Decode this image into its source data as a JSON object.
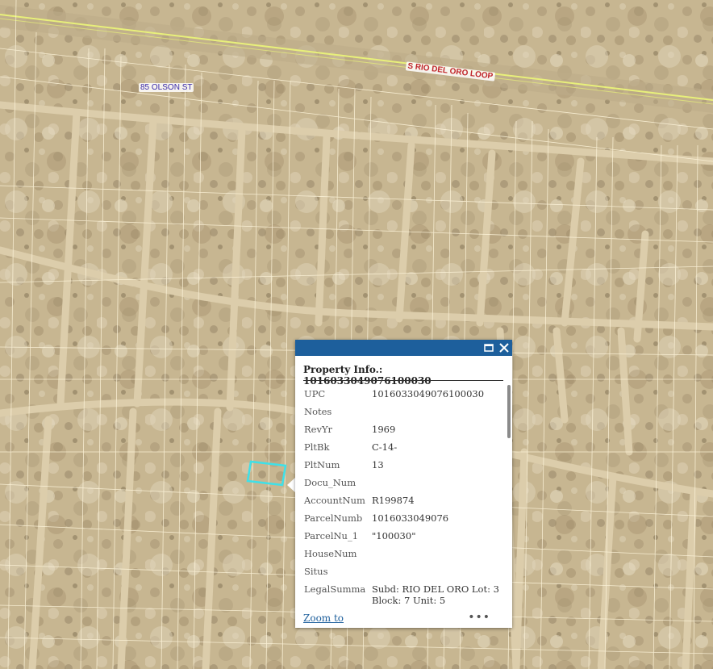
{
  "map": {
    "road_labels": {
      "olson": "85 OLSON ST",
      "rio_del_oro": "S RIO DEL ORO LOOP"
    },
    "colors": {
      "imagery_base": "#c9b897",
      "parcel_lines": "#fff8e4",
      "road": "#d9c9a6",
      "highway_line": "#e8f07a",
      "selection": "#3fe0e8"
    }
  },
  "popup": {
    "title": "Property Info.: 1016033049076100030",
    "header_color": "#1d5f9c",
    "maximize_icon": "maximize-icon",
    "close_icon": "close-icon",
    "fields": [
      {
        "key": "UPC",
        "value": "1016033049076100030"
      },
      {
        "key": "Notes",
        "value": ""
      },
      {
        "key": "RevYr",
        "value": "1969"
      },
      {
        "key": "PltBk",
        "value": "C-14-"
      },
      {
        "key": "PltNum",
        "value": "13"
      },
      {
        "key": "Docu_Num",
        "value": ""
      },
      {
        "key": "AccountNum",
        "value": "R199874"
      },
      {
        "key": "ParcelNumb",
        "value": "1016033049076"
      },
      {
        "key": "ParcelNu_1",
        "value": "\"100030\""
      },
      {
        "key": "HouseNum",
        "value": ""
      },
      {
        "key": "Situs",
        "value": ""
      },
      {
        "key": "LegalSumma",
        "value": "Subd: RIO DEL ORO Lot: 3 Block: 7 Unit: 5"
      }
    ],
    "zoom_to": "Zoom to",
    "more": "•••"
  }
}
